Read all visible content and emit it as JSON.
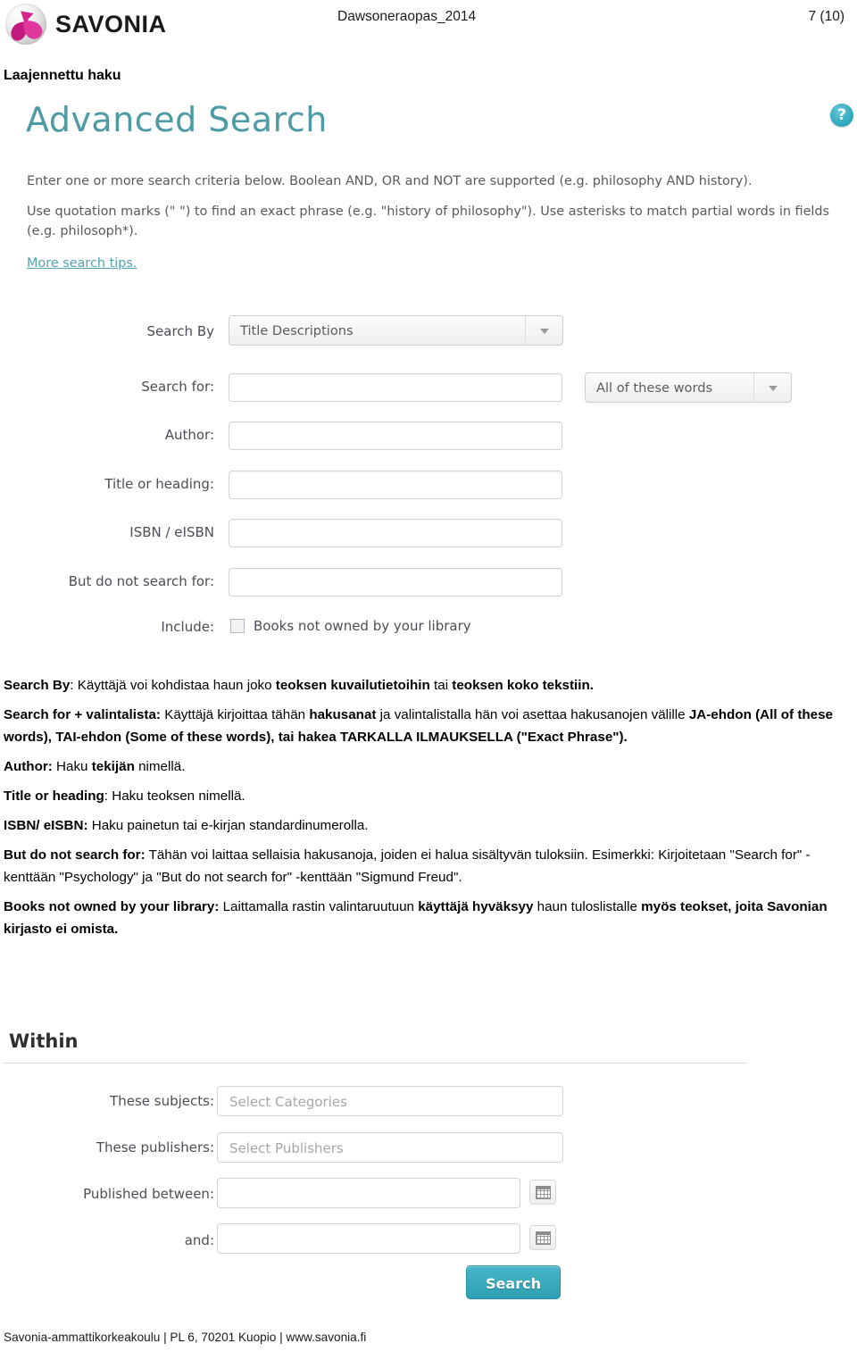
{
  "header": {
    "logo_text": "SAVONIA",
    "document_title": "Dawsoneraopas_2014",
    "page_number": "7 (10)"
  },
  "section_heading": "Laajennettu haku",
  "advanced_search": {
    "title": "Advanced Search",
    "help_icon": "question-mark-icon",
    "intro_line_1": "Enter one or more search criteria below. Boolean AND, OR and NOT are supported (e.g. philosophy AND history).",
    "intro_line_2": "Use quotation marks (\" \") to find an exact phrase (e.g. \"history of philosophy\"). Use asterisks to match partial words in fields (e.g. philosoph*).",
    "more_tips_link": "More search tips.",
    "fields": {
      "search_by_label": "Search By",
      "search_by_value": "Title Descriptions",
      "search_for_label": "Search for:",
      "search_for_value": "",
      "match_mode_value": "All of these words",
      "author_label": "Author:",
      "author_value": "",
      "title_or_heading_label": "Title or heading:",
      "title_or_heading_value": "",
      "isbn_label": "ISBN / eISBN",
      "isbn_value": "",
      "exclude_label": "But do not search for:",
      "exclude_value": "",
      "include_label": "Include:",
      "include_checkbox_label": "Books not owned by your library"
    }
  },
  "body_paragraphs": [
    {
      "runs": [
        {
          "t": "Search By",
          "b": true
        },
        {
          "t": ": Käyttäjä voi kohdistaa haun joko ",
          "b": false
        },
        {
          "t": "teoksen kuvailutietoihin",
          "b": true
        },
        {
          "t": " tai ",
          "b": false
        },
        {
          "t": "teoksen koko tekstiin.",
          "b": true
        }
      ]
    },
    {
      "runs": [
        {
          "t": "Search for + valintalista:",
          "b": true
        },
        {
          "t": " Käyttäjä kirjoittaa tähän ",
          "b": false
        },
        {
          "t": "hakusanat",
          "b": true
        },
        {
          "t": " ja valintalistalla hän voi asettaa hakusanojen välille ",
          "b": false
        },
        {
          "t": "JA-ehdon (All of these words), TAI-ehdon (Some of these words), tai hakea TARKALLA ILMAUKSELLA (\"Exact Phrase\").",
          "b": true
        }
      ]
    },
    {
      "runs": [
        {
          "t": "Author:",
          "b": true
        },
        {
          "t": " Haku ",
          "b": false
        },
        {
          "t": "tekijän",
          "b": true
        },
        {
          "t": " nimellä.",
          "b": false
        }
      ]
    },
    {
      "runs": [
        {
          "t": "Title or heading",
          "b": true
        },
        {
          "t": ": Haku teoksen nimellä.",
          "b": false
        }
      ]
    },
    {
      "runs": [
        {
          "t": "ISBN/ eISBN:",
          "b": true
        },
        {
          "t": " Haku painetun tai e-kirjan standardinumerolla.",
          "b": false
        }
      ]
    },
    {
      "runs": [
        {
          "t": "But do not search for:",
          "b": true
        },
        {
          "t": " Tähän voi laittaa sellaisia hakusanoja, joiden ei halua sisältyvän tuloksiin. Esimerkki: Kirjoitetaan \"Search for\" -kenttään \"Psychology\" ja \"But do not search for\" -kenttään \"Sigmund Freud\".",
          "b": false
        }
      ]
    },
    {
      "runs": [
        {
          "t": "Books not owned by your library:",
          "b": true
        },
        {
          "t": " Laittamalla rastin valintaruutuun ",
          "b": false
        },
        {
          "t": "käyttäjä hyväksyy",
          "b": true
        },
        {
          "t": " haun tuloslistalle ",
          "b": false
        },
        {
          "t": "myös teokset, joita Savonian kirjasto ei omista.",
          "b": true
        }
      ]
    }
  ],
  "within": {
    "title": "Within",
    "these_subjects_label": "These subjects:",
    "these_subjects_placeholder": "Select Categories",
    "these_publishers_label": "These publishers:",
    "these_publishers_placeholder": "Select Publishers",
    "published_between_label": "Published between:",
    "published_between_value": "",
    "and_label": "and:",
    "and_value": "",
    "calendar_icon": "calendar-icon",
    "search_button": "Search"
  },
  "footer": "Savonia-ammattikorkeakoulu | PL 6, 70201 Kuopio | www.savonia.fi",
  "colors": {
    "accent_teal": "#4d9aa4",
    "button_teal": "#2e9fb2",
    "logo_magenta": "#d6248a",
    "placeholder_grey": "#a7a7a7"
  }
}
